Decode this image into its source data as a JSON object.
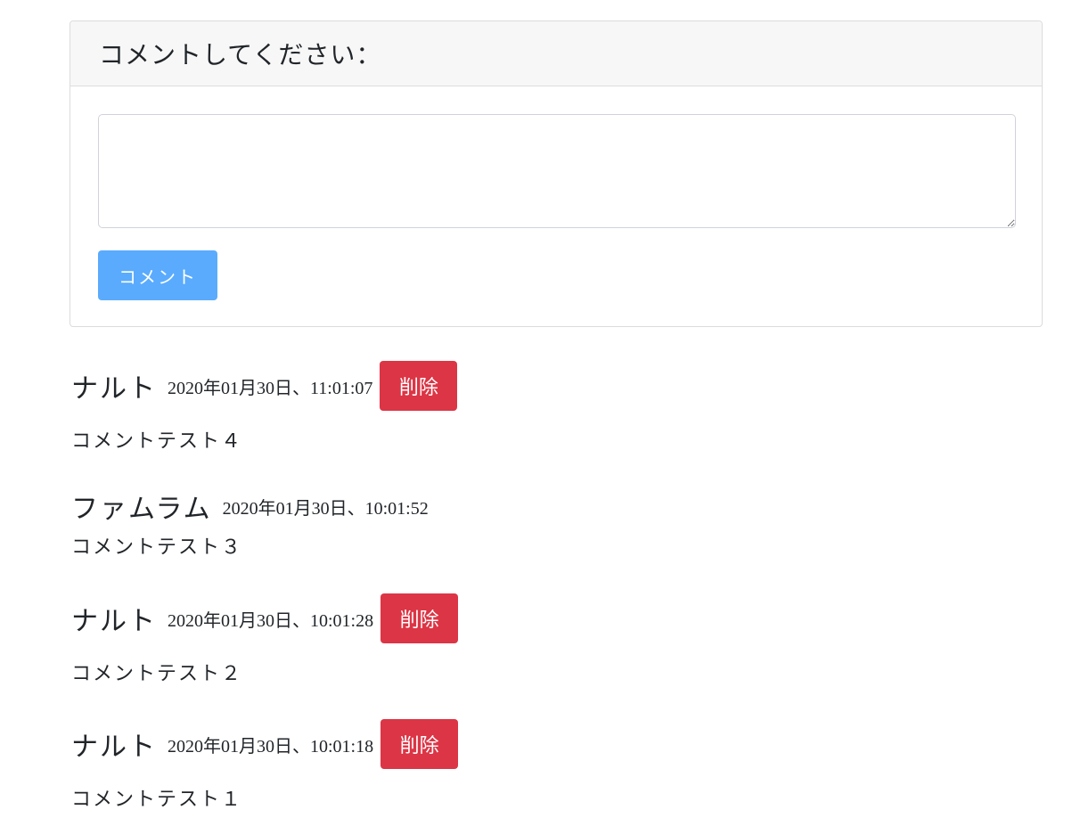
{
  "form": {
    "header": "コメントしてください：",
    "textarea_value": "",
    "submit_label": "コメント"
  },
  "comments": [
    {
      "author": "ナルト",
      "timestamp": "2020年01月30日、11:01:07",
      "delete_label": "削除",
      "body": "コメントテスト４"
    },
    {
      "author": "ファムラム",
      "timestamp": "2020年01月30日、10:01:52",
      "delete_label": "",
      "body": "コメントテスト３"
    },
    {
      "author": "ナルト",
      "timestamp": "2020年01月30日、10:01:28",
      "delete_label": "削除",
      "body": "コメントテスト２"
    },
    {
      "author": "ナルト",
      "timestamp": "2020年01月30日、10:01:18",
      "delete_label": "削除",
      "body": "コメントテスト１"
    }
  ],
  "colors": {
    "submit_button": "#5aabfd",
    "delete_button": "#dc3545",
    "header_bg": "#f7f7f7"
  }
}
